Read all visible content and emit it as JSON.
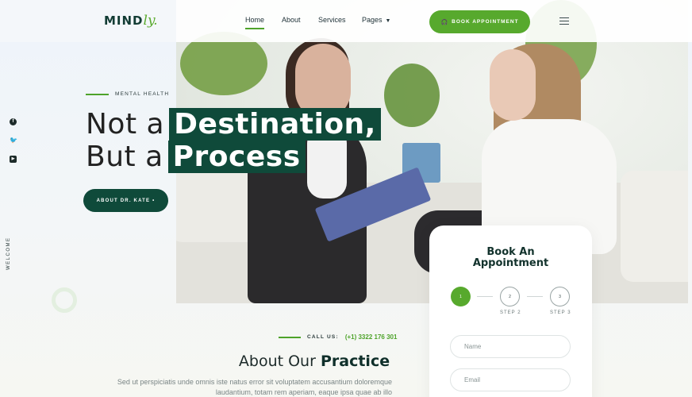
{
  "brand": {
    "logo_main": "MIND",
    "logo_script": "ly."
  },
  "nav": {
    "items": [
      {
        "label": "Home",
        "active": true
      },
      {
        "label": "About",
        "active": false
      },
      {
        "label": "Services",
        "active": false
      },
      {
        "label": "Pages",
        "active": false,
        "has_dropdown": true
      }
    ],
    "cta_label": "BOOK APPOINTMENT",
    "cta_icon": "headphones-icon"
  },
  "social": [
    {
      "icon": "facebook-icon",
      "glyph": "f"
    },
    {
      "icon": "twitter-icon",
      "glyph": "𝕥"
    },
    {
      "icon": "youtube-icon",
      "glyph": "▶"
    }
  ],
  "sidebar": {
    "welcome": "WELCOME"
  },
  "hero": {
    "eyebrow": "MENTAL HEALTH",
    "line1_plain": "Not a",
    "line1_highlight": "Destination,",
    "line2_plain": "But a",
    "line2_highlight": "Process",
    "button_label": "ABOUT DR. KATE •"
  },
  "about": {
    "call_label": "CALL US:",
    "phone": "(+1) 3322 176 301",
    "title_plain": "About Our",
    "title_bold": "Practice",
    "text": "Sed ut perspiciatis unde omnis iste natus error sit voluptatem accusantium doloremque laudantium, totam rem aperiam, eaque ipsa quae ab illo"
  },
  "booking": {
    "title_line1": "Book An",
    "title_line2": "Appointment",
    "steps": [
      {
        "number": "1",
        "label": "",
        "active": true
      },
      {
        "number": "2",
        "label": "STEP 2",
        "active": false
      },
      {
        "number": "3",
        "label": "STEP 3",
        "active": false
      }
    ],
    "name_placeholder": "Name",
    "email_placeholder": "Email"
  },
  "colors": {
    "accent_green": "#57a92d",
    "dark_green": "#0f4a3a"
  }
}
